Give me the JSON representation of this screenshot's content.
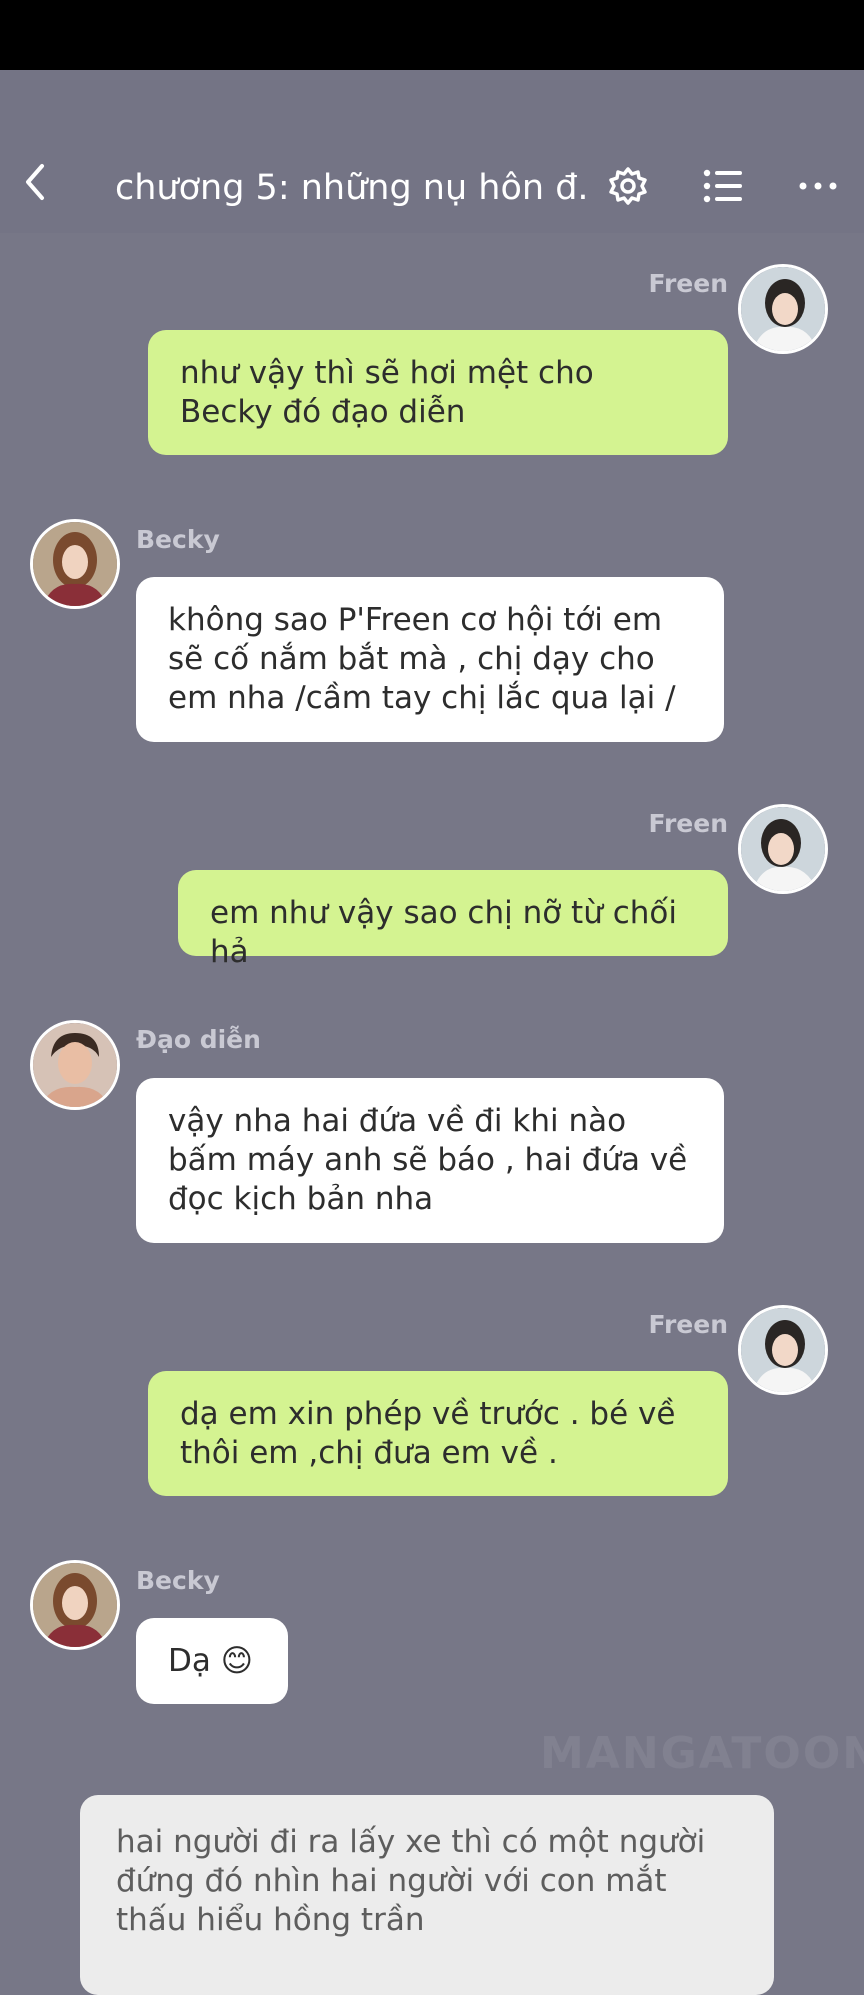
{
  "header": {
    "title": "chương 5: những nụ hôn đ...",
    "back_icon": "chevron-left-icon",
    "settings_icon": "gear-icon",
    "list_icon": "list-icon",
    "more_icon": "more-horizontal-icon"
  },
  "messages": [
    {
      "sender": "Freen",
      "side": "right",
      "text": "như vậy thì sẽ hơi mệt cho Becky đó đạo diễn"
    },
    {
      "sender": "Becky",
      "side": "left",
      "text": "không sao P'Freen cơ hội tới em sẽ cố nắm bắt mà , chị dạy cho em nha /cầm tay chị lắc qua lại /"
    },
    {
      "sender": "Freen",
      "side": "right",
      "text": "em như vậy sao chị nỡ từ chối hả"
    },
    {
      "sender": "Đạo diễn",
      "side": "left",
      "text": "vậy nha hai đứa về đi khi nào bấm máy anh sẽ báo , hai đứa về đọc kịch bản nha"
    },
    {
      "sender": "Freen",
      "side": "right",
      "text": "dạ em xin phép về trước . bé về thôi em ,chị đưa em về ."
    },
    {
      "sender": "Becky",
      "side": "left",
      "text": "Dạ 😊"
    }
  ],
  "narration": {
    "text": "hai người đi ra lấy xe thì có một người đứng đó nhìn hai người với con mắt thấu hiểu hồng trần"
  },
  "watermark": "MANGATOON",
  "colors": {
    "background": "#777787",
    "header": "#747485",
    "sent_bubble": "#d4f391",
    "received_bubble": "#ffffff",
    "narration_bubble": "#ececec",
    "sender_name": "#c9c9d3"
  }
}
